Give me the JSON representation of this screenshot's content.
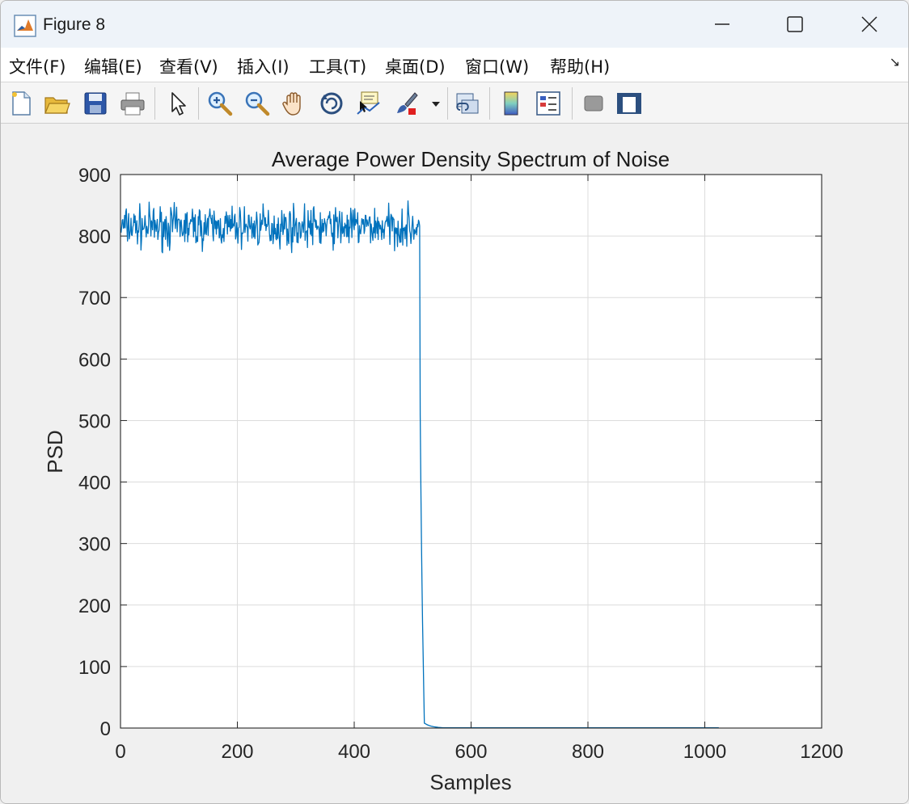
{
  "window": {
    "title": "Figure 8",
    "controls": [
      "minimize",
      "maximize",
      "close"
    ]
  },
  "menu": {
    "items": [
      {
        "label": "文件(F)"
      },
      {
        "label": "编辑(E)"
      },
      {
        "label": "查看(V)"
      },
      {
        "label": "插入(I)"
      },
      {
        "label": "工具(T)"
      },
      {
        "label": "桌面(D)"
      },
      {
        "label": "窗口(W)"
      },
      {
        "label": "帮助(H)"
      }
    ],
    "overflow_icon": "dock-arrow-icon"
  },
  "toolbar": {
    "icons": [
      "new-figure-icon",
      "open-file-icon",
      "save-icon",
      "print-icon",
      "select-arrow-icon",
      "zoom-in-icon",
      "zoom-out-icon",
      "pan-hand-icon",
      "rotate-3d-icon",
      "data-cursor-icon",
      "brush-icon",
      "dropdown-icon",
      "link-plot-icon",
      "colorbar-icon",
      "legend-icon",
      "hide-plot-tools-icon",
      "show-plot-tools-icon"
    ]
  },
  "chart_data": {
    "type": "line",
    "title": "Average Power Density Spectrum of Noise",
    "xlabel": "Samples",
    "ylabel": "PSD",
    "xlim": [
      0,
      1200
    ],
    "ylim": [
      0,
      900
    ],
    "xticks": [
      "0",
      "200",
      "400",
      "600",
      "800",
      "1000",
      "1200"
    ],
    "yticks": [
      "0",
      "100",
      "200",
      "300",
      "400",
      "500",
      "600",
      "700",
      "800",
      "900"
    ],
    "grid": true,
    "color": "#0072bd",
    "series": [
      {
        "description_segments": [
          {
            "x_range": [
              1,
              512
            ],
            "mean": 815,
            "spread": 25,
            "min": 772,
            "max": 872
          },
          {
            "x_range": [
              512,
              520
            ],
            "from": 780,
            "to": 10
          },
          {
            "x_range": [
              520,
              1024
            ],
            "value": 0.5
          }
        ]
      }
    ]
  }
}
